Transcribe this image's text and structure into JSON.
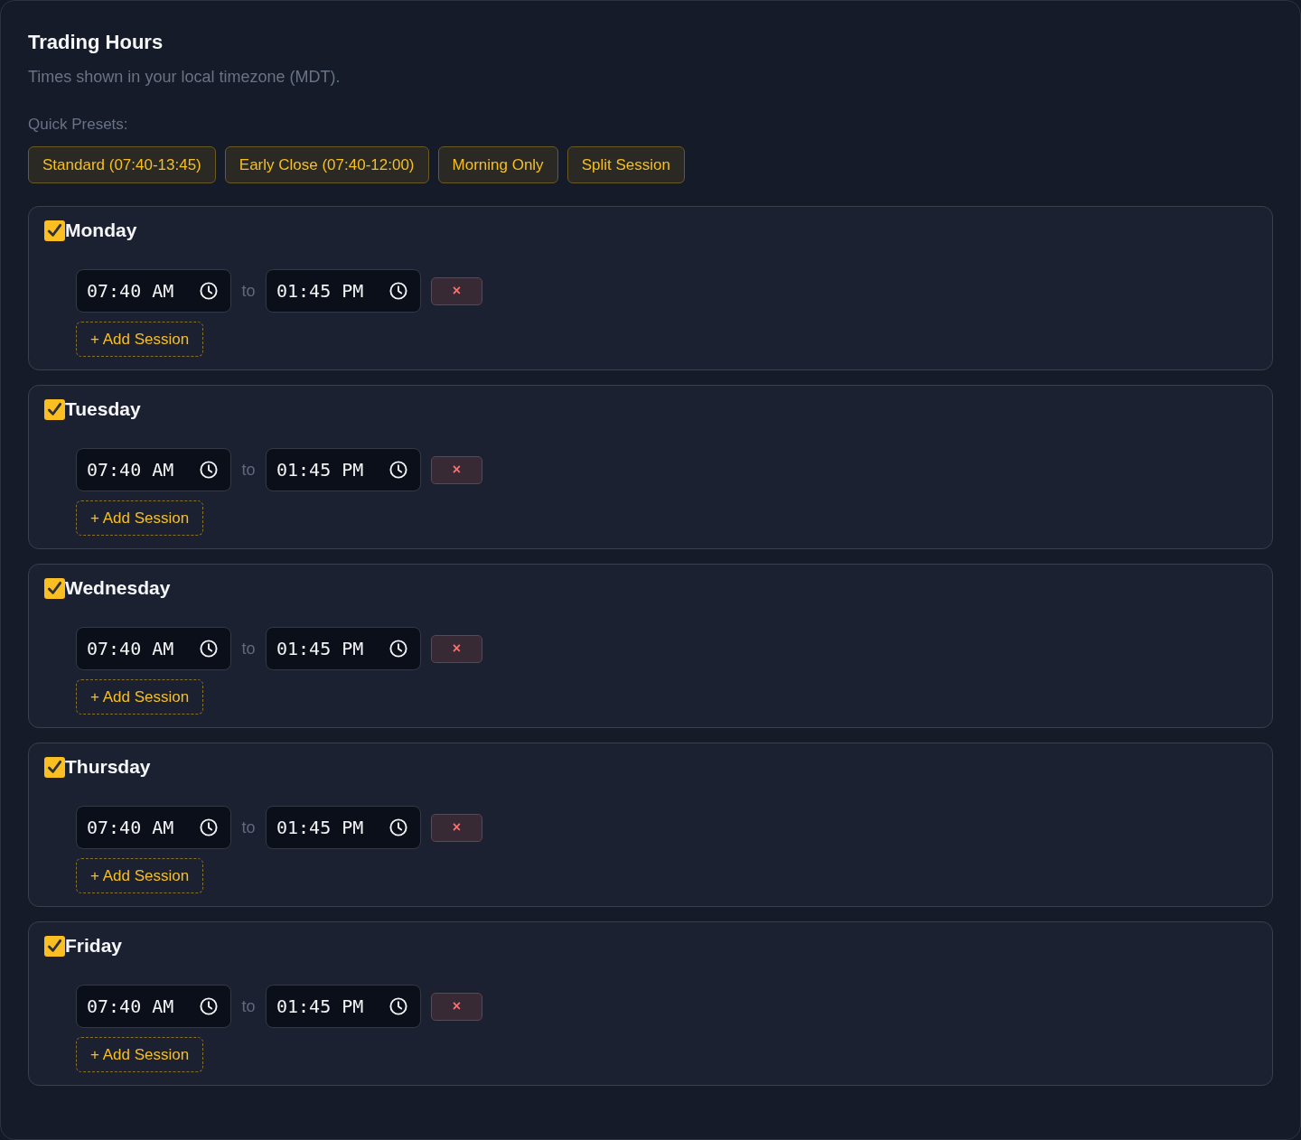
{
  "header": {
    "title": "Trading Hours",
    "subtitle": "Times shown in your local timezone (MDT)."
  },
  "presets": {
    "label": "Quick Presets:",
    "buttons": [
      "Standard (07:40-13:45)",
      "Early Close (07:40-12:00)",
      "Morning Only",
      "Split Session"
    ]
  },
  "days": [
    {
      "label": "Monday",
      "checked": true,
      "sessions": [
        {
          "start": "07:40 AM",
          "separator": "to",
          "end": "01:45 PM",
          "remove": "×"
        }
      ],
      "add_session": "+ Add Session"
    },
    {
      "label": "Tuesday",
      "checked": true,
      "sessions": [
        {
          "start": "07:40 AM",
          "separator": "to",
          "end": "01:45 PM",
          "remove": "×"
        }
      ],
      "add_session": "+ Add Session"
    },
    {
      "label": "Wednesday",
      "checked": true,
      "sessions": [
        {
          "start": "07:40 AM",
          "separator": "to",
          "end": "01:45 PM",
          "remove": "×"
        }
      ],
      "add_session": "+ Add Session"
    },
    {
      "label": "Thursday",
      "checked": true,
      "sessions": [
        {
          "start": "07:40 AM",
          "separator": "to",
          "end": "01:45 PM",
          "remove": "×"
        }
      ],
      "add_session": "+ Add Session"
    },
    {
      "label": "Friday",
      "checked": true,
      "sessions": [
        {
          "start": "07:40 AM",
          "separator": "to",
          "end": "01:45 PM",
          "remove": "×"
        }
      ],
      "add_session": "+ Add Session"
    }
  ]
}
